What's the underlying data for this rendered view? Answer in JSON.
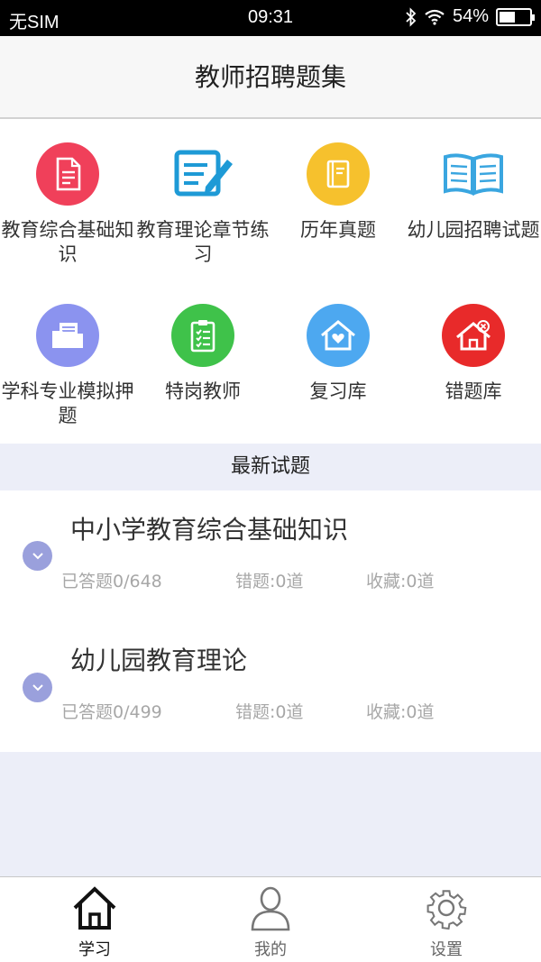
{
  "status_bar": {
    "carrier": "无SIM",
    "time": "09:31",
    "battery": "54%",
    "battery_level": 0.54
  },
  "header": {
    "title": "教师招聘题集"
  },
  "grid": {
    "items": [
      {
        "label": "教育综合基础知识",
        "icon": "document-icon",
        "color": "#f0405a"
      },
      {
        "label": "教育理论章节练习",
        "icon": "edit-note-icon",
        "color": "#1e9ad6"
      },
      {
        "label": "历年真题",
        "icon": "book-icon",
        "color": "#f6c12d"
      },
      {
        "label": "幼儿园招聘试题",
        "icon": "open-book-icon",
        "color": "#3aa6e0"
      },
      {
        "label": "学科专业模拟押题",
        "icon": "folder-icon",
        "color": "#8b93ef"
      },
      {
        "label": "特岗教师",
        "icon": "clipboard-icon",
        "color": "#3fc24a"
      },
      {
        "label": "复习库",
        "icon": "home-heart-icon",
        "color": "#4da8f0"
      },
      {
        "label": "错题库",
        "icon": "home-x-icon",
        "color": "#e82a2a"
      }
    ]
  },
  "section": {
    "title": "最新试题"
  },
  "banks": [
    {
      "name": "中小学教育综合基础知识",
      "answered": "已答题0/648",
      "wrong": "错题:0道",
      "favorites": "收藏:0道"
    },
    {
      "name": "幼儿园教育理论",
      "answered": "已答题0/499",
      "wrong": "错题:0道",
      "favorites": "收藏:0道"
    }
  ],
  "tabbar": {
    "tabs": [
      {
        "label": "学习",
        "icon": "home-icon",
        "active": true
      },
      {
        "label": "我的",
        "icon": "person-icon",
        "active": false
      },
      {
        "label": "设置",
        "icon": "gear-icon",
        "active": false
      }
    ]
  }
}
